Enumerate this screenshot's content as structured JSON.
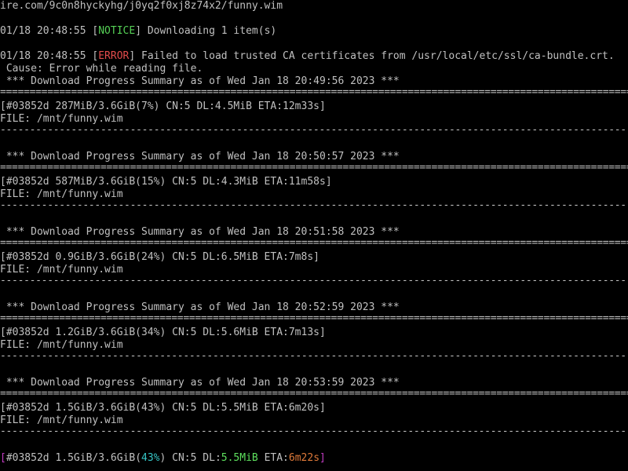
{
  "url_line": "ire.com/9c0n8hyckyhg/j0yq2f0xj8z74x2/funny.wim",
  "notice": {
    "ts": "01/18 20:48:55 [",
    "tag": "NOTICE",
    "msg": "] Downloading 1 item(s)"
  },
  "error": {
    "ts": "01/18 20:48:55 [",
    "tag": "ERROR",
    "msg": "] Failed to load trusted CA certificates from /usr/local/etc/ssl/ca-bundle.crt."
  },
  "cause": " Cause: Error while reading file.",
  "double_rule": "====================================================================================================================",
  "single_rule": "--------------------------------------------------------------------------------------------------------------------",
  "blocks": [
    {
      "header": " *** Download Progress Summary as of Wed Jan 18 20:49:56 2023 ***",
      "progress": "[#03852d 287MiB/3.6GiB(7%) CN:5 DL:4.5MiB ETA:12m33s]",
      "file": "FILE: /mnt/funny.wim"
    },
    {
      "header": " *** Download Progress Summary as of Wed Jan 18 20:50:57 2023 ***",
      "progress": "[#03852d 587MiB/3.6GiB(15%) CN:5 DL:4.3MiB ETA:11m58s]",
      "file": "FILE: /mnt/funny.wim"
    },
    {
      "header": " *** Download Progress Summary as of Wed Jan 18 20:51:58 2023 ***",
      "progress": "[#03852d 0.9GiB/3.6GiB(24%) CN:5 DL:6.5MiB ETA:7m8s]",
      "file": "FILE: /mnt/funny.wim"
    },
    {
      "header": " *** Download Progress Summary as of Wed Jan 18 20:52:59 2023 ***",
      "progress": "[#03852d 1.2GiB/3.6GiB(34%) CN:5 DL:5.6MiB ETA:7m13s]",
      "file": "FILE: /mnt/funny.wim"
    },
    {
      "header": " *** Download Progress Summary as of Wed Jan 18 20:53:59 2023 ***",
      "progress": "[#03852d 1.5GiB/3.6GiB(43%) CN:5 DL:5.5MiB ETA:6m20s]",
      "file": "FILE: /mnt/funny.wim"
    }
  ],
  "status": {
    "open": "[",
    "id_size": "#03852d 1.5GiB/3.6GiB(",
    "pct": "43%",
    "after_pct": ") CN:5 DL:",
    "dl": "5.5MiB",
    "eta_label": " ETA:",
    "eta": "6m22s",
    "close": "]"
  }
}
